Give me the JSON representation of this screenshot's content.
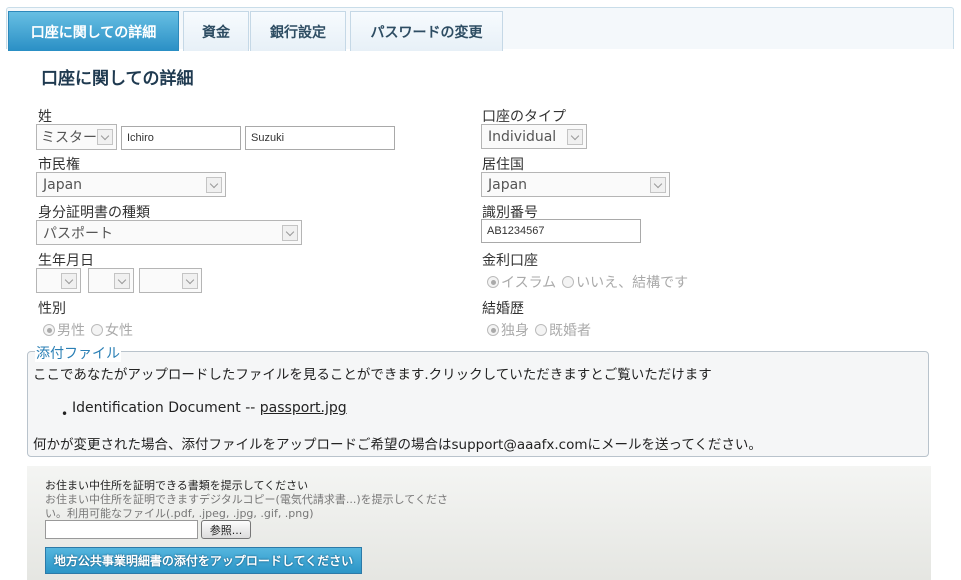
{
  "tabs": [
    {
      "label": "口座に関しての詳細",
      "active": true
    },
    {
      "label": "資金",
      "active": false
    },
    {
      "label": "銀行設定",
      "active": false
    },
    {
      "label": "パスワードの変更",
      "active": false
    }
  ],
  "page_title": "口座に関しての詳細",
  "form": {
    "name_label": "姓",
    "salutation": "ミスター",
    "first_name": "Ichiro",
    "last_name": "Suzuki",
    "account_type_label": "口座のタイプ",
    "account_type": "Individual",
    "citizenship_label": "市民権",
    "citizenship": "Japan",
    "residence_label": "居住国",
    "residence": "Japan",
    "id_type_label": "身分証明書の種類",
    "id_type": "パスポート",
    "id_number_label": "識別番号",
    "id_number": "AB1234567",
    "dob_label": "生年月日",
    "interest_label": "金利口座",
    "interest_options": [
      "イスラム",
      "いいえ、結構です"
    ],
    "gender_label": "性別",
    "gender_options": [
      "男性",
      "女性"
    ],
    "marital_label": "結婚歴",
    "marital_options": [
      "独身",
      "既婚者"
    ]
  },
  "attachments": {
    "legend": "添付ファイル",
    "intro": "ここであなたがアップロードしたファイルを見ることができます.クリックしていただきますとご覧いただけます",
    "doc_label": "Identification Document --",
    "doc_link": "passport.jpg",
    "note": "何かが変更された場合、添付ファイルをアップロードご希望の場合はsupport@aaafx.comにメールを送ってください。"
  },
  "upload": {
    "title": "お住まい中住所を証明できる書類を提示してください",
    "desc_line1": "お住まい中住所を証明できますデジタルコピー(電気代請求書...)を提示してくださ",
    "desc_line2": "い。利用可能なファイル(.pdf, .jpeg, .jpg, .gif, .png)",
    "browse_label": "参照...",
    "button_label": "地方公共事業明細書の添付をアップロードしてください"
  }
}
